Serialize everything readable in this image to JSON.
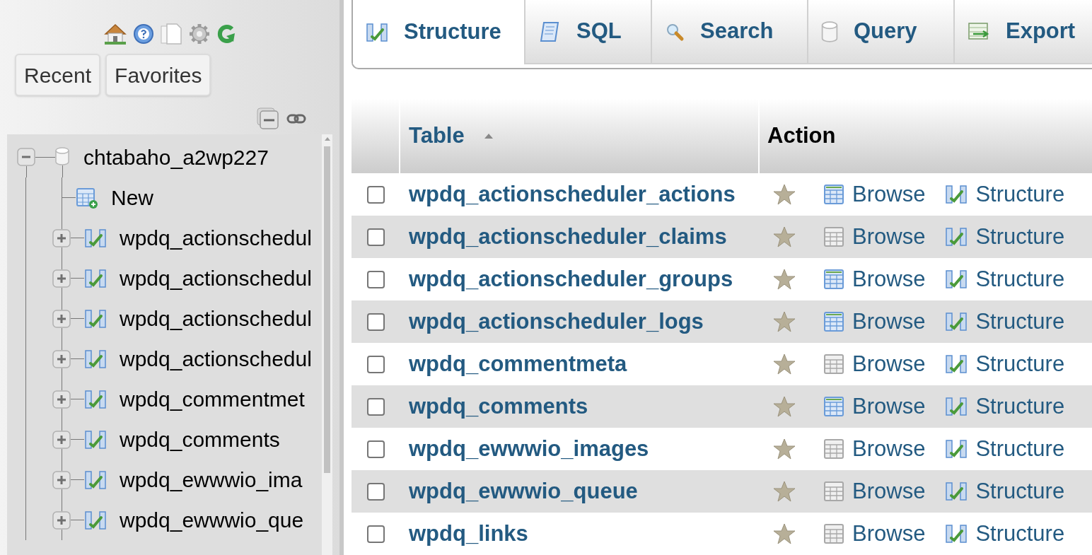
{
  "nav_tabs": [
    {
      "label": "Recent"
    },
    {
      "label": "Favorites"
    }
  ],
  "tree": {
    "name": "chtabaho_a2wp227",
    "expanded": true,
    "children": [
      {
        "kind": "new",
        "label": "New"
      },
      {
        "kind": "table",
        "label": "wpdq_actionschedul",
        "expanded": false
      },
      {
        "kind": "table",
        "label": "wpdq_actionschedul",
        "expanded": false
      },
      {
        "kind": "table",
        "label": "wpdq_actionschedul",
        "expanded": false
      },
      {
        "kind": "table",
        "label": "wpdq_actionschedul",
        "expanded": false
      },
      {
        "kind": "table",
        "label": "wpdq_commentmet",
        "expanded": false
      },
      {
        "kind": "table",
        "label": "wpdq_comments",
        "expanded": false
      },
      {
        "kind": "table",
        "label": "wpdq_ewwwio_ima",
        "expanded": false
      },
      {
        "kind": "table",
        "label": "wpdq_ewwwio_que",
        "expanded": false
      }
    ]
  },
  "tabs": [
    {
      "kind": "structure",
      "label": "Structure",
      "selected": true
    },
    {
      "kind": "sql",
      "label": "SQL",
      "selected": false
    },
    {
      "kind": "search",
      "label": "Search",
      "selected": false
    },
    {
      "kind": "query",
      "label": "Query",
      "selected": false
    },
    {
      "kind": "export",
      "label": "Export",
      "selected": false
    }
  ],
  "table": {
    "columns": [
      "Table",
      "Action"
    ],
    "sort_ascending": true,
    "rows": [
      {
        "name": "wpdq_actionscheduler_actions",
        "checked": false,
        "has_rows": true,
        "actions": [
          "Browse",
          "Structure"
        ]
      },
      {
        "name": "wpdq_actionscheduler_claims",
        "checked": false,
        "has_rows": false,
        "actions": [
          "Browse",
          "Structure"
        ]
      },
      {
        "name": "wpdq_actionscheduler_groups",
        "checked": false,
        "has_rows": true,
        "actions": [
          "Browse",
          "Structure"
        ]
      },
      {
        "name": "wpdq_actionscheduler_logs",
        "checked": false,
        "has_rows": true,
        "actions": [
          "Browse",
          "Structure"
        ]
      },
      {
        "name": "wpdq_commentmeta",
        "checked": false,
        "has_rows": false,
        "actions": [
          "Browse",
          "Structure"
        ]
      },
      {
        "name": "wpdq_comments",
        "checked": false,
        "has_rows": true,
        "actions": [
          "Browse",
          "Structure"
        ]
      },
      {
        "name": "wpdq_ewwwio_images",
        "checked": false,
        "has_rows": false,
        "actions": [
          "Browse",
          "Structure"
        ]
      },
      {
        "name": "wpdq_ewwwio_queue",
        "checked": false,
        "has_rows": false,
        "actions": [
          "Browse",
          "Structure"
        ]
      },
      {
        "name": "wpdq_links",
        "checked": false,
        "has_rows": false,
        "actions": [
          "Browse",
          "Structure"
        ]
      }
    ]
  }
}
